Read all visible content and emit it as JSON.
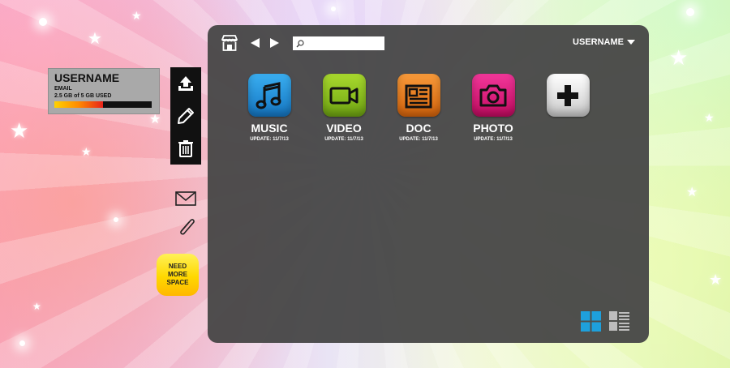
{
  "user": {
    "name": "USERNAME",
    "email": "EMAIL",
    "usage_text": "2.5 GB of 5 GB USED",
    "usage_fraction": 0.5
  },
  "toolbar": {
    "items": [
      {
        "icon": "upload-icon"
      },
      {
        "icon": "pencil-icon"
      },
      {
        "icon": "trash-icon"
      }
    ]
  },
  "side_icons": [
    {
      "icon": "mail-icon"
    },
    {
      "icon": "paperclip-icon"
    }
  ],
  "need_space_label": "NEED MORE SPACE",
  "topbar": {
    "store_icon": "store-icon",
    "search_placeholder": "",
    "username": "USERNAME"
  },
  "apps": [
    {
      "label": "MUSIC",
      "update": "UPDATE: 11/7/13",
      "icon": "music-note-icon",
      "color": "#1e8ed6"
    },
    {
      "label": "VIDEO",
      "update": "UPDATE: 11/7/13",
      "icon": "video-camera-icon",
      "color": "#8cc31e"
    },
    {
      "label": "DOC",
      "update": "UPDATE: 11/7/13",
      "icon": "document-icon",
      "color": "#ef7f1a"
    },
    {
      "label": "PHOTO",
      "update": "UPDATE: 11/7/13",
      "icon": "camera-icon",
      "color": "#e4167d"
    },
    {
      "label": "",
      "update": "",
      "icon": "plus-icon",
      "color": "#dcdcdc"
    }
  ],
  "view_toggle": {
    "grid_icon": "grid-view-icon",
    "list_icon": "list-view-icon",
    "active_color": "#1ea0dc"
  }
}
